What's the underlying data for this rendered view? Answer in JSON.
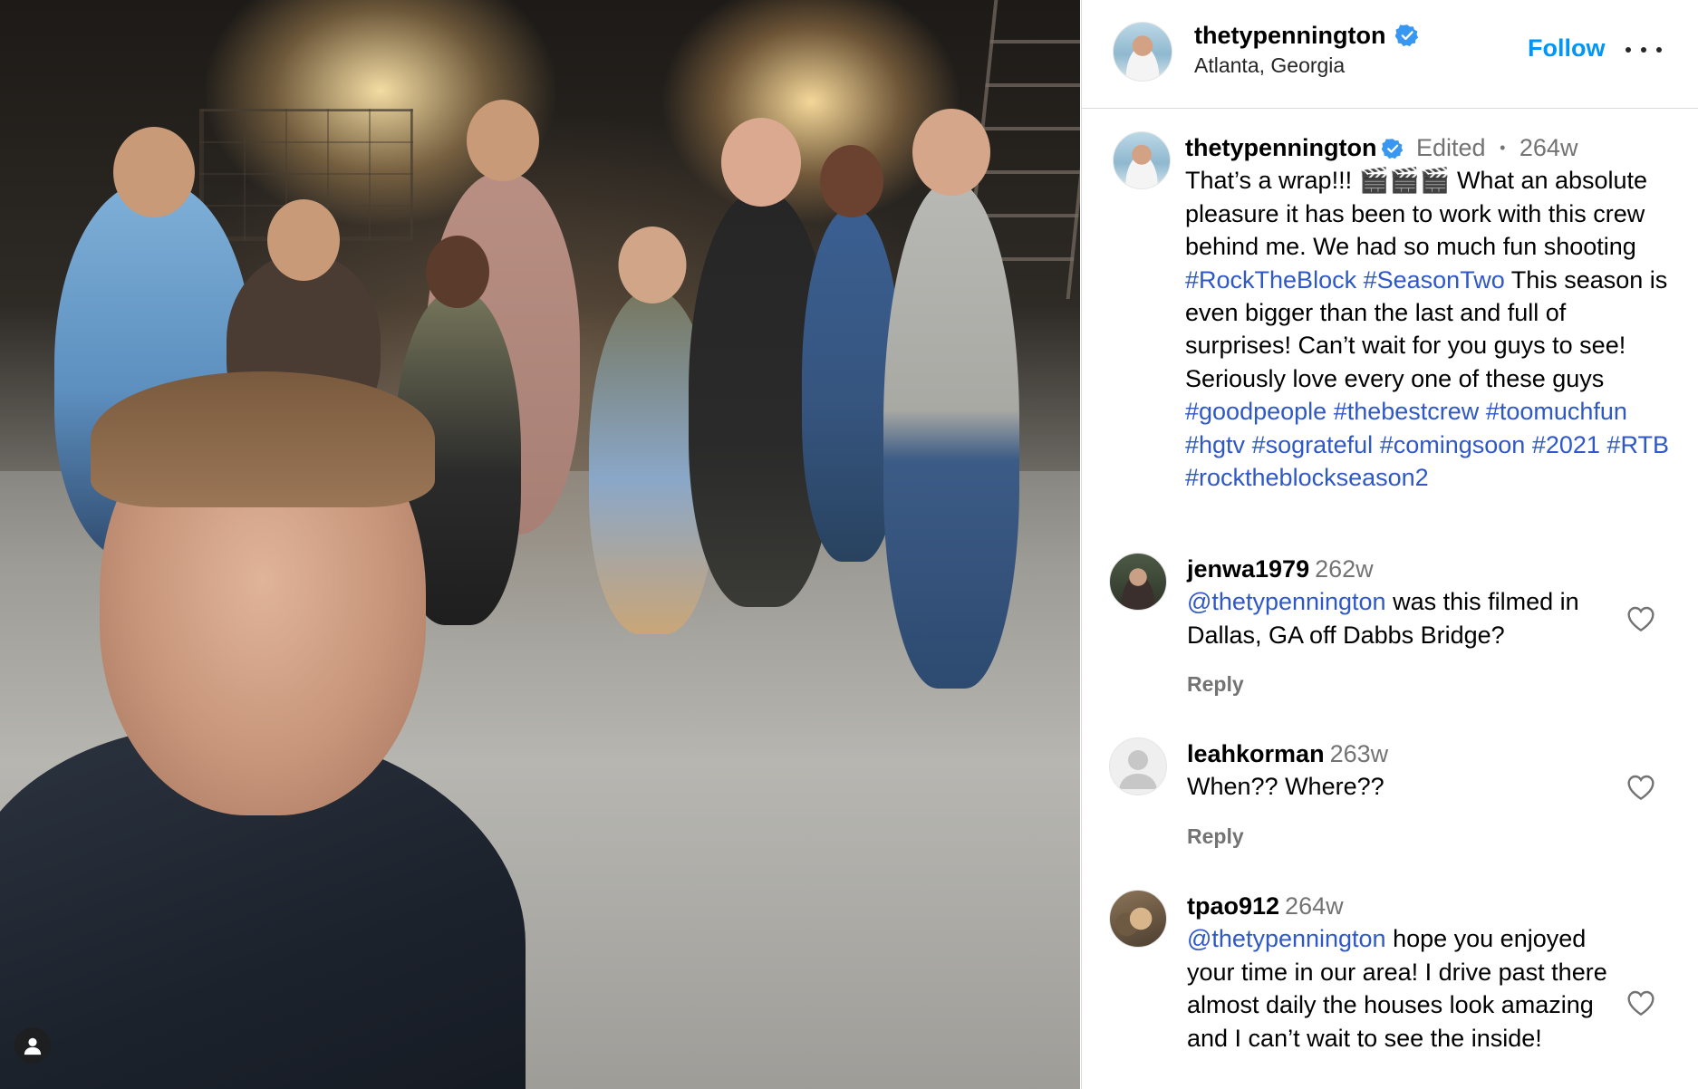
{
  "post": {
    "author": "thetypennington",
    "location": "Atlanta, Georgia",
    "follow_label": "Follow",
    "more_label": "•••"
  },
  "caption": {
    "author": "thetypennington",
    "edited": "Edited",
    "separator": "•",
    "time": "264w",
    "text_1": "That’s a wrap!!! 🎬🎬🎬 What an absolute pleasure it has been to work with this crew behind me. We had so much fun shooting ",
    "tag_rocktheblock": "#RockTheBlock",
    "tag_seasontwo": "#SeasonTwo",
    "text_2": " This season is even bigger than the last and full of surprises! Can’t wait for you guys to see! Seriously love every one of these guys ",
    "tags_tail": [
      "#goodpeople",
      "#thebestcrew",
      "#toomuchfun",
      "#hgtv",
      "#sograteful",
      "#comingsoon",
      "#2021",
      "#RTB",
      "#rocktheblockseason2"
    ]
  },
  "comments": [
    {
      "user": "jenwa1979",
      "time": "262w",
      "mention": "@thetypennington",
      "text": " was this filmed in Dallas, GA off Dabbs Bridge?",
      "reply_label": "Reply"
    },
    {
      "user": "leahkorman",
      "time": "263w",
      "mention": "",
      "text": "When?? Where??",
      "reply_label": "Reply"
    },
    {
      "user": "tpao912",
      "time": "264w",
      "mention": "@thetypennington",
      "text": " hope you enjoyed your time in our area! I drive past there almost daily the houses look amazing and I can’t wait to see the inside!",
      "reply_label": ""
    }
  ],
  "icons": {
    "verified": "verified-badge-icon",
    "heart": "heart-icon",
    "more": "more-options-icon",
    "profile": "person-icon"
  },
  "colors": {
    "link": "#2f58c7",
    "follow": "#0095f6",
    "muted": "#737373",
    "verified": "#3897f0"
  }
}
